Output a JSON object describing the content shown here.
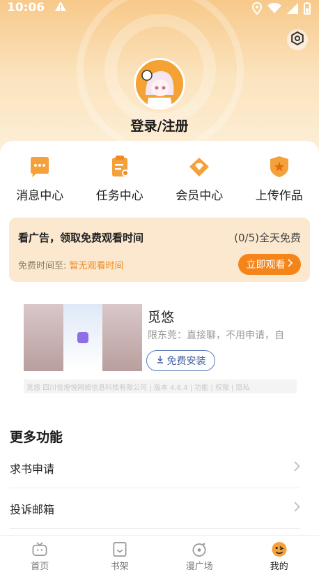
{
  "status": {
    "time": "10:06"
  },
  "profile": {
    "login_label": "登录/注册"
  },
  "quick_actions": [
    {
      "label": "消息中心",
      "icon": "message-icon"
    },
    {
      "label": "任务中心",
      "icon": "task-icon"
    },
    {
      "label": "会员中心",
      "icon": "vip-diamond-icon"
    },
    {
      "label": "上传作品",
      "icon": "upload-shield-icon"
    }
  ],
  "ad_reward": {
    "title": "看广告，领取免费观看时间",
    "count": "(0/5)全天免费",
    "free_time_label": "免费时间至:",
    "free_time_value": "暂无观看时间",
    "button_label": "立即观看"
  },
  "promo": {
    "title": "觅悠",
    "description": "限东莞：直接聊，不用申请，自",
    "button_label": "免费安装",
    "meta": "觅悠 四川省煌悦网络信息科技有限公司 | 版本 4.6.4 | 功能 | 权限 | 隐私"
  },
  "more": {
    "title": "更多功能",
    "items": [
      {
        "label": "求书申请"
      },
      {
        "label": "投诉邮箱"
      }
    ]
  },
  "tabs": [
    {
      "label": "首页",
      "active": false
    },
    {
      "label": "书架",
      "active": false
    },
    {
      "label": "漫广场",
      "active": false
    },
    {
      "label": "我的",
      "active": true
    }
  ],
  "colors": {
    "accent": "#f5851a",
    "header": "#f7c98a",
    "ad_bg": "#fbe8cf"
  }
}
